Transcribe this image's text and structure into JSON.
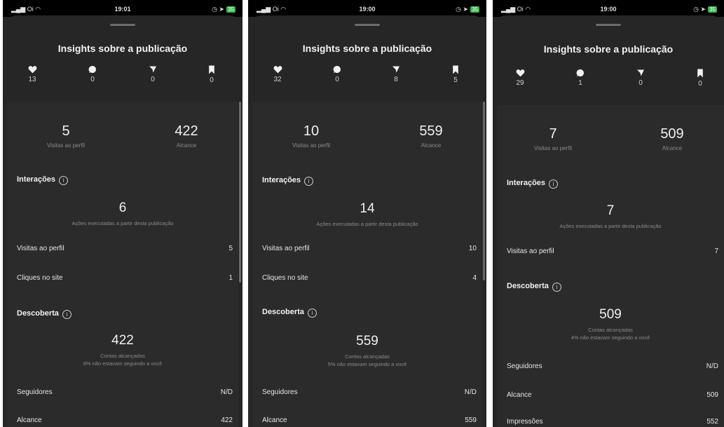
{
  "screens": [
    {
      "status": {
        "carrier": "Oi",
        "time": "19:01",
        "battery": "35"
      },
      "title": "Insights sobre a publicação",
      "metrics": {
        "likes": "13",
        "comments": "0",
        "shares": "0",
        "saves": "0"
      },
      "profile_visits": {
        "value": "5",
        "label": "Visitas ao perfil"
      },
      "reach": {
        "value": "422",
        "label": "Alcance"
      },
      "interactions": {
        "heading": "Interações",
        "value": "6",
        "sub": "Ações executadas a partir desta publicação"
      },
      "rows1": [
        {
          "label": "Visitas ao perfil",
          "value": "5"
        },
        {
          "label": "Cliques no site",
          "value": "1"
        }
      ],
      "discovery": {
        "heading": "Descoberta",
        "value": "422",
        "sub1": "Contas alcançadas",
        "sub2": "9% não estavam seguindo a você"
      },
      "rows2": [
        {
          "label": "Seguidores",
          "value": "N/D"
        },
        {
          "label": "Alcance",
          "value": "422"
        }
      ]
    },
    {
      "status": {
        "carrier": "Oi",
        "time": "19:00",
        "battery": "35"
      },
      "title": "Insights sobre a publicação",
      "metrics": {
        "likes": "32",
        "comments": "0",
        "shares": "8",
        "saves": "5"
      },
      "profile_visits": {
        "value": "10",
        "label": "Visitas ao perfil"
      },
      "reach": {
        "value": "559",
        "label": "Alcance"
      },
      "interactions": {
        "heading": "Interações",
        "value": "14",
        "sub": "Ações executadas a partir desta publicação"
      },
      "rows1": [
        {
          "label": "Visitas ao perfil",
          "value": "10"
        },
        {
          "label": "Cliques no site",
          "value": "4"
        }
      ],
      "discovery": {
        "heading": "Descoberta",
        "value": "559",
        "sub1": "Contas alcançadas",
        "sub2": "5% não estavam seguindo a você"
      },
      "rows2": [
        {
          "label": "Seguidores",
          "value": "N/D"
        },
        {
          "label": "Alcance",
          "value": "559"
        }
      ]
    },
    {
      "status": {
        "carrier": "Oi",
        "time": "19:00",
        "battery": "35"
      },
      "title": "Insights sobre a publicação",
      "metrics": {
        "likes": "29",
        "comments": "1",
        "shares": "0",
        "saves": "0"
      },
      "profile_visits": {
        "value": "7",
        "label": "Visitas ao perfil"
      },
      "reach": {
        "value": "509",
        "label": "Alcance"
      },
      "interactions": {
        "heading": "Interações",
        "value": "7",
        "sub": "Ações executadas a partir desta publicação"
      },
      "rows1": [
        {
          "label": "Visitas ao perfil",
          "value": "7"
        }
      ],
      "discovery": {
        "heading": "Descoberta",
        "value": "509",
        "sub1": "Contas alcançadas",
        "sub2": "4% não estavam seguindo a você"
      },
      "rows2": [
        {
          "label": "Seguidores",
          "value": "N/D"
        },
        {
          "label": "Alcance",
          "value": "509"
        },
        {
          "label": "Impressões",
          "value": "552"
        }
      ]
    }
  ]
}
